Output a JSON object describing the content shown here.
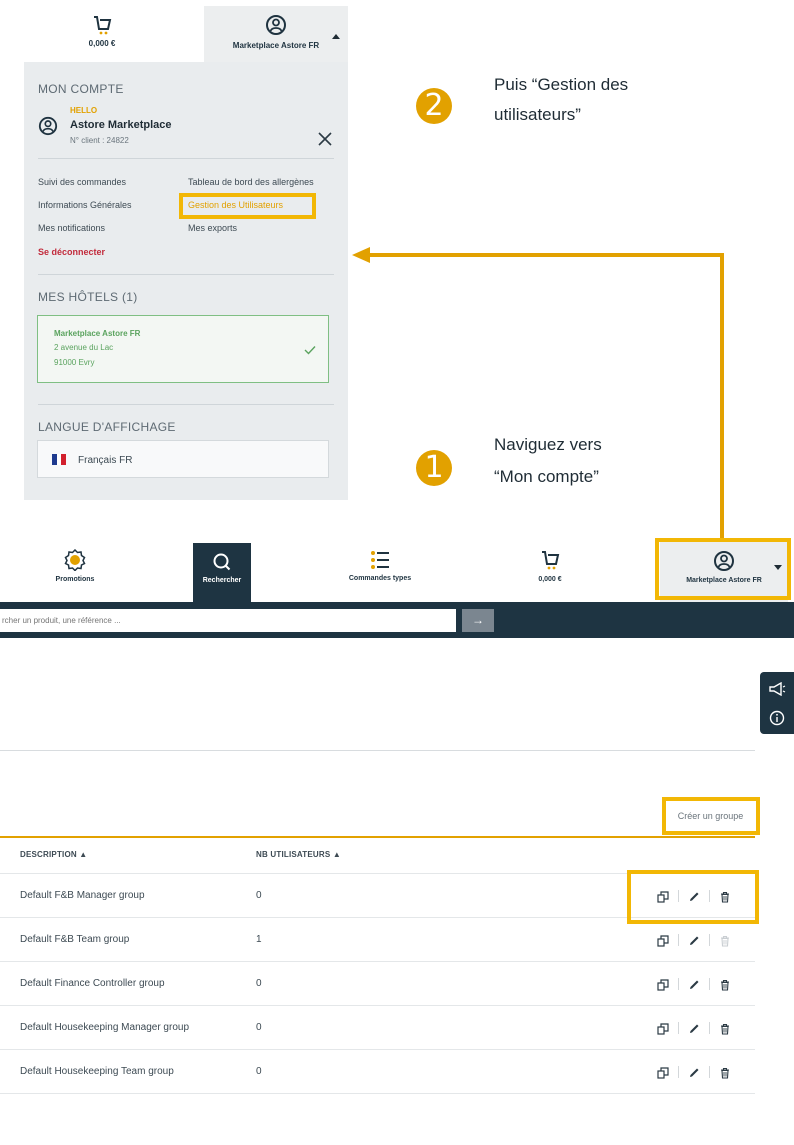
{
  "top_header": {
    "cart_amount": "0,000 €",
    "account_label": "Marketplace Astore FR"
  },
  "panel": {
    "title": "MON COMPTE",
    "hello": "HELLO",
    "user_name": "Astore Marketplace",
    "client_number": "N° client : 24822",
    "links_left": [
      "Suivi des commandes",
      "Informations Générales",
      "Mes notifications"
    ],
    "links_right": [
      "Tableau de bord des allergènes",
      "Gestion des Utilisateurs",
      "Mes exports"
    ],
    "logout": "Se déconnecter",
    "hotels_title": "MES HÔTELS (1)",
    "hotel": {
      "name": "Marketplace Astore FR",
      "address": "2 avenue du Lac",
      "city": "91000 Evry"
    },
    "language_title": "LANGUE D'AFFICHAGE",
    "language": "Français FR"
  },
  "annotations": {
    "step2_number": "2",
    "step2_line1": "Puis “Gestion des",
    "step2_line2": "utilisateurs”",
    "step1_number": "1",
    "step1_line1": "Naviguez vers",
    "step1_line2": "“Mon compte”"
  },
  "nav": {
    "items": [
      {
        "label": "Promotions",
        "icon": "promotion-badge-icon"
      },
      {
        "label": "Rechercher",
        "icon": "search-icon"
      },
      {
        "label": "Commandes types",
        "icon": "list-icon"
      },
      {
        "label": "0,000 €",
        "icon": "cart-icon"
      },
      {
        "label": "Marketplace Astore FR",
        "icon": "user-circle-icon"
      }
    ]
  },
  "search": {
    "placeholder": "rcher un produit, une référence ...",
    "button": "→"
  },
  "table": {
    "create_button": "Créer un groupe",
    "headers": {
      "description": "DESCRIPTION ▲",
      "nb_users": "NB UTILISATEURS ▲"
    },
    "rows": [
      {
        "description": "Default F&B Manager group",
        "nb_users": "0",
        "delete_enabled": true
      },
      {
        "description": "Default F&B Team group",
        "nb_users": "1",
        "delete_enabled": false
      },
      {
        "description": "Default Finance Controller group",
        "nb_users": "0",
        "delete_enabled": true
      },
      {
        "description": "Default Housekeeping Manager group",
        "nb_users": "0",
        "delete_enabled": true
      },
      {
        "description": "Default Housekeeping Team group",
        "nb_users": "0",
        "delete_enabled": true
      }
    ]
  },
  "colors": {
    "accent": "#e2a100",
    "navy": "#1e3442",
    "success": "#5aa35e",
    "danger": "#c22b3c"
  }
}
